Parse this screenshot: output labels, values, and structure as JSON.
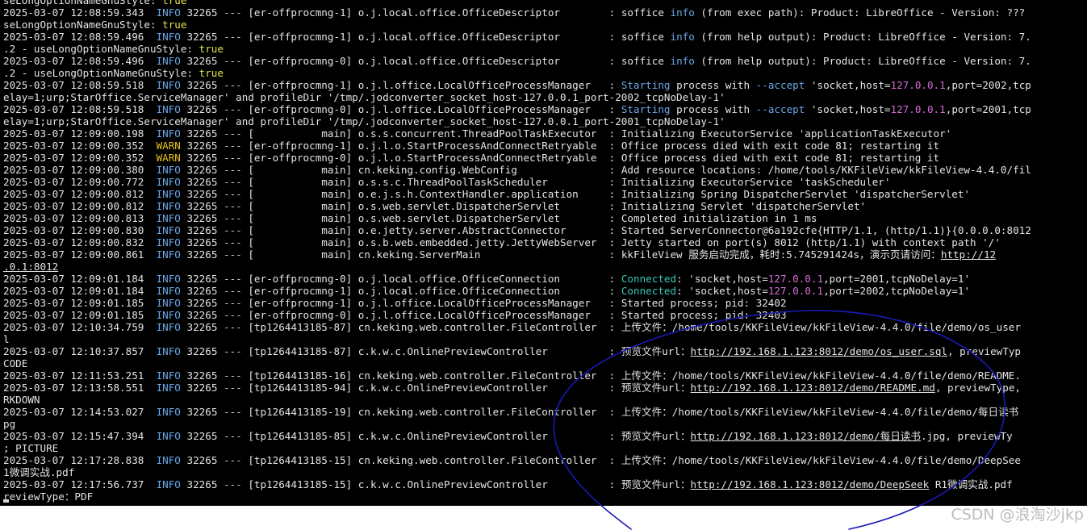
{
  "terminal": {
    "lines": [
      [
        {
          "t": "seLongOptionNameGnuStyle: "
        },
        {
          "t": "true",
          "c": "true"
        }
      ],
      [
        {
          "t": "2025-03-07 12:08:59.343  "
        },
        {
          "t": "INFO",
          "c": "info"
        },
        {
          "t": " 32265 "
        },
        {
          "t": "---",
          "c": "dash"
        },
        {
          "t": " [er-offprocmng-1] o.j.local.office.OfficeDescriptor        : soffice "
        },
        {
          "t": "info",
          "c": "info"
        },
        {
          "t": " (from exec path): Product: LibreOffice - Version: ???"
        }
      ],
      [
        {
          "t": "seLongOptionNameGnuStyle: "
        },
        {
          "t": "true",
          "c": "true"
        }
      ],
      [
        {
          "t": "2025-03-07 12:08:59.496  "
        },
        {
          "t": "INFO",
          "c": "info"
        },
        {
          "t": " 32265 "
        },
        {
          "t": "---",
          "c": "dash"
        },
        {
          "t": " [er-offprocmng-1] o.j.local.office.OfficeDescriptor        : soffice "
        },
        {
          "t": "info",
          "c": "info"
        },
        {
          "t": " (from help output): Product: LibreOffice - Version: 7."
        }
      ],
      [
        {
          "t": ".2 - useLongOptionNameGnuStyle: "
        },
        {
          "t": "true",
          "c": "true"
        }
      ],
      [
        {
          "t": "2025-03-07 12:08:59.496  "
        },
        {
          "t": "INFO",
          "c": "info"
        },
        {
          "t": " 32265 "
        },
        {
          "t": "---",
          "c": "dash"
        },
        {
          "t": " [er-offprocmng-0] o.j.local.office.OfficeDescriptor        : soffice "
        },
        {
          "t": "info",
          "c": "info"
        },
        {
          "t": " (from help output): Product: LibreOffice - Version: 7."
        }
      ],
      [
        {
          "t": ".2 - useLongOptionNameGnuStyle: "
        },
        {
          "t": "true",
          "c": "true"
        }
      ],
      [
        {
          "t": "2025-03-07 12:08:59.518  "
        },
        {
          "t": "INFO",
          "c": "info"
        },
        {
          "t": " 32265 "
        },
        {
          "t": "---",
          "c": "dash"
        },
        {
          "t": " [er-offprocmng-1] o.j.l.office.LocalOfficeProcessManager   : "
        },
        {
          "t": "Starting",
          "c": "info"
        },
        {
          "t": " process with "
        },
        {
          "t": "--accept",
          "c": "info"
        },
        {
          "t": " 'socket,host="
        },
        {
          "t": "127.0.0.1",
          "c": "ip"
        },
        {
          "t": ",port=2002,tcp"
        }
      ],
      [
        {
          "t": "elay=1;urp;StarOffice.ServiceManager' and profileDir '/tmp/.jodconverter_socket_host-127.0.0.1_port-2002_tcpNoDelay-1'"
        }
      ],
      [
        {
          "t": "2025-03-07 12:08:59.518  "
        },
        {
          "t": "INFO",
          "c": "info"
        },
        {
          "t": " 32265 "
        },
        {
          "t": "---",
          "c": "dash"
        },
        {
          "t": " [er-offprocmng-0] o.j.l.office.LocalOfficeProcessManager   : "
        },
        {
          "t": "Starting",
          "c": "info"
        },
        {
          "t": " process with "
        },
        {
          "t": "--accept",
          "c": "info"
        },
        {
          "t": " 'socket,host="
        },
        {
          "t": "127.0.0.1",
          "c": "ip"
        },
        {
          "t": ",port=2001,tcp"
        }
      ],
      [
        {
          "t": "elay=1;urp;StarOffice.ServiceManager' and profileDir '/tmp/.jodconverter_socket_host-127.0.0.1_port-2001_tcpNoDelay-1'"
        }
      ],
      [
        {
          "t": "2025-03-07 12:09:00.198  "
        },
        {
          "t": "INFO",
          "c": "info"
        },
        {
          "t": " 32265 "
        },
        {
          "t": "---",
          "c": "dash"
        },
        {
          "t": " [           main] o.s.s.concurrent.ThreadPoolTaskExecutor  : Initializing ExecutorService 'applicationTaskExecutor'"
        }
      ],
      [
        {
          "t": "2025-03-07 12:09:00.352  "
        },
        {
          "t": "WARN",
          "c": "warn"
        },
        {
          "t": " 32265 "
        },
        {
          "t": "---",
          "c": "dash"
        },
        {
          "t": " [er-offprocmng-1] o.j.l.o.StartProcessAndConnectRetryable  : Office process died with exit code 81; restarting it"
        }
      ],
      [
        {
          "t": "2025-03-07 12:09:00.352  "
        },
        {
          "t": "WARN",
          "c": "warn"
        },
        {
          "t": " 32265 "
        },
        {
          "t": "---",
          "c": "dash"
        },
        {
          "t": " [er-offprocmng-0] o.j.l.o.StartProcessAndConnectRetryable  : Office process died with exit code 81; restarting it"
        }
      ],
      [
        {
          "t": "2025-03-07 12:09:00.380  "
        },
        {
          "t": "INFO",
          "c": "info"
        },
        {
          "t": " 32265 "
        },
        {
          "t": "---",
          "c": "dash"
        },
        {
          "t": " [           main] cn.keking.config.WebConfig               : Add resource locations: /home/tools/KKFileView/kkFileView-4.4.0/fil"
        }
      ],
      [
        {
          "t": "2025-03-07 12:09:00.772  "
        },
        {
          "t": "INFO",
          "c": "info"
        },
        {
          "t": " 32265 "
        },
        {
          "t": "---",
          "c": "dash"
        },
        {
          "t": " [           main] o.s.s.c.ThreadPoolTaskScheduler          : Initializing ExecutorService 'taskScheduler'"
        }
      ],
      [
        {
          "t": "2025-03-07 12:09:00.812  "
        },
        {
          "t": "INFO",
          "c": "info"
        },
        {
          "t": " 32265 "
        },
        {
          "t": "---",
          "c": "dash"
        },
        {
          "t": " [           main] o.e.j.s.h.ContextHandler.application     : Initializing Spring DispatcherServlet 'dispatcherServlet'"
        }
      ],
      [
        {
          "t": "2025-03-07 12:09:00.812  "
        },
        {
          "t": "INFO",
          "c": "info"
        },
        {
          "t": " 32265 "
        },
        {
          "t": "---",
          "c": "dash"
        },
        {
          "t": " [           main] o.s.web.servlet.DispatcherServlet        : Initializing Servlet 'dispatcherServlet'"
        }
      ],
      [
        {
          "t": "2025-03-07 12:09:00.813  "
        },
        {
          "t": "INFO",
          "c": "info"
        },
        {
          "t": " 32265 "
        },
        {
          "t": "---",
          "c": "dash"
        },
        {
          "t": " [           main] o.s.web.servlet.DispatcherServlet        : Completed initialization in 1 ms"
        }
      ],
      [
        {
          "t": "2025-03-07 12:09:00.830  "
        },
        {
          "t": "INFO",
          "c": "info"
        },
        {
          "t": " 32265 "
        },
        {
          "t": "---",
          "c": "dash"
        },
        {
          "t": " [           main] o.e.jetty.server.AbstractConnector       : Started ServerConnector@6a192cfe{HTTP/1.1, (http/1.1)}{0.0.0.0:8012"
        }
      ],
      [
        {
          "t": "2025-03-07 12:09:00.832  "
        },
        {
          "t": "INFO",
          "c": "info"
        },
        {
          "t": " 32265 "
        },
        {
          "t": "---",
          "c": "dash"
        },
        {
          "t": " [           main] o.s.b.web.embedded.jetty.JettyWebServer  : Jetty started on port(s) 8012 (http/1.1) with context path '/'"
        }
      ],
      [
        {
          "t": "2025-03-07 12:09:00.861  "
        },
        {
          "t": "INFO",
          "c": "info"
        },
        {
          "t": " 32265 "
        },
        {
          "t": "---",
          "c": "dash"
        },
        {
          "t": " [           main] cn.keking.ServerMain                     : kkFileView 服务启动完成，耗时:5.745291424s，演示页请访问："
        },
        {
          "t": "http://12",
          "c": "link"
        }
      ],
      [
        {
          "t": ".0.1:8012",
          "c": "link"
        }
      ],
      [
        {
          "t": "2025-03-07 12:09:01.184  "
        },
        {
          "t": "INFO",
          "c": "info"
        },
        {
          "t": " 32265 "
        },
        {
          "t": "---",
          "c": "dash"
        },
        {
          "t": " [er-offprocmng-0] o.j.local.office.OfficeConnection        : "
        },
        {
          "t": "Connected",
          "c": "conn"
        },
        {
          "t": ": 'socket,host="
        },
        {
          "t": "127.0.0.1",
          "c": "ip"
        },
        {
          "t": ",port=2001,tcpNoDelay=1'"
        }
      ],
      [
        {
          "t": "2025-03-07 12:09:01.184  "
        },
        {
          "t": "INFO",
          "c": "info"
        },
        {
          "t": " 32265 "
        },
        {
          "t": "---",
          "c": "dash"
        },
        {
          "t": " [er-offprocmng-1] o.j.local.office.OfficeConnection        : "
        },
        {
          "t": "Connected",
          "c": "conn"
        },
        {
          "t": ": 'socket,host="
        },
        {
          "t": "127.0.0.1",
          "c": "ip"
        },
        {
          "t": ",port=2002,tcpNoDelay=1'"
        }
      ],
      [
        {
          "t": "2025-03-07 12:09:01.185  "
        },
        {
          "t": "INFO",
          "c": "info"
        },
        {
          "t": " 32265 "
        },
        {
          "t": "---",
          "c": "dash"
        },
        {
          "t": " [er-offprocmng-1] o.j.l.office.LocalOfficeProcessManager   : Started process; pid: 32402"
        }
      ],
      [
        {
          "t": "2025-03-07 12:09:01.185  "
        },
        {
          "t": "INFO",
          "c": "info"
        },
        {
          "t": " 32265 "
        },
        {
          "t": "---",
          "c": "dash"
        },
        {
          "t": " [er-offprocmng-0] o.j.l.office.LocalOfficeProcessManager   : Started process; pid: 32403"
        }
      ],
      [
        {
          "t": "2025-03-07 12:10:34.759  "
        },
        {
          "t": "INFO",
          "c": "info"
        },
        {
          "t": " 32265 "
        },
        {
          "t": "---",
          "c": "dash"
        },
        {
          "t": " [tp1264413185-87] cn.keking.web.controller.FileController  : 上传文件：/home/tools/KKFileView/kkFileView-4.4.0/file/demo/os_user"
        }
      ],
      [
        {
          "t": "l"
        }
      ],
      [
        {
          "t": "2025-03-07 12:10:37.857  "
        },
        {
          "t": "INFO",
          "c": "info"
        },
        {
          "t": " 32265 "
        },
        {
          "t": "---",
          "c": "dash"
        },
        {
          "t": " [tp1264413185-87] c.k.w.c.OnlinePreviewController          : 预览文件url："
        },
        {
          "t": "http://192.168.1.123:8012/demo/os_user.sql",
          "c": "link"
        },
        {
          "t": ", previewTyp"
        }
      ],
      [
        {
          "t": "CODE"
        }
      ],
      [
        {
          "t": "2025-03-07 12:11:53.251  "
        },
        {
          "t": "INFO",
          "c": "info"
        },
        {
          "t": " 32265 "
        },
        {
          "t": "---",
          "c": "dash"
        },
        {
          "t": " [tp1264413185-16] cn.keking.web.controller.FileController  : 上传文件：/home/tools/KKFileView/kkFileView-4.4.0/file/demo/README."
        }
      ],
      [
        {
          "t": "2025-03-07 12:13:58.551  "
        },
        {
          "t": "INFO",
          "c": "info"
        },
        {
          "t": " 32265 "
        },
        {
          "t": "---",
          "c": "dash"
        },
        {
          "t": " [tp1264413185-94] c.k.w.c.OnlinePreviewController          : 预览文件url："
        },
        {
          "t": "http://192.168.1.123:8012/demo/README.md",
          "c": "link"
        },
        {
          "t": ", previewType,"
        }
      ],
      [
        {
          "t": "RKDOWN"
        }
      ],
      [
        {
          "t": "2025-03-07 12:14:53.027  "
        },
        {
          "t": "INFO",
          "c": "info"
        },
        {
          "t": " 32265 "
        },
        {
          "t": "---",
          "c": "dash"
        },
        {
          "t": " [tp1264413185-19] cn.keking.web.controller.FileController  : 上传文件：/home/tools/KKFileView/kkFileView-4.4.0/file/demo/每日读书"
        }
      ],
      [
        {
          "t": "pg"
        }
      ],
      [
        {
          "t": "2025-03-07 12:15:47.394  "
        },
        {
          "t": "INFO",
          "c": "info"
        },
        {
          "t": " 32265 "
        },
        {
          "t": "---",
          "c": "dash"
        },
        {
          "t": " [tp1264413185-85] c.k.w.c.OnlinePreviewController          : 预览文件url："
        },
        {
          "t": "http://192.168.1.123:8012/demo/",
          "c": "link"
        },
        {
          "t": "每日读书",
          "c": "link"
        },
        {
          "t": ".jpg, previewTy"
        }
      ],
      [
        {
          "t": "; PICTURE"
        }
      ],
      [
        {
          "t": "2025-03-07 12:17:28.838  "
        },
        {
          "t": "INFO",
          "c": "info"
        },
        {
          "t": " 32265 "
        },
        {
          "t": "---",
          "c": "dash"
        },
        {
          "t": " [tp1264413185-15] cn.keking.web.controller.FileController  : 上传文件：/home/tools/KKFileView/kkFileView-4.4.0/file/demo/DeepSee"
        }
      ],
      [
        {
          "t": "1微调实战.pdf"
        }
      ],
      [
        {
          "t": "2025-03-07 12:17:56.737  "
        },
        {
          "t": "INFO",
          "c": "info"
        },
        {
          "t": " 32265 "
        },
        {
          "t": "---",
          "c": "dash"
        },
        {
          "t": " [tp1264413185-15] c.k.w.c.OnlinePreviewController          : 预览文件url："
        },
        {
          "t": "http://192.168.1.123:8012/demo/DeepSeek",
          "c": "link"
        },
        {
          "t": " R1微调实战.pdf"
        }
      ],
      [
        {
          "t": "reviewType：PDF"
        }
      ]
    ]
  },
  "watermark": "CSDN @浪淘沙jkp",
  "colors": {
    "background": "#000000",
    "text": "#e4e4e4",
    "info": "#6aa7e8",
    "warn": "#e3c01f",
    "connected": "#39c6b8",
    "ip": "#d66bd4",
    "annotation": "#1a1ab8"
  }
}
